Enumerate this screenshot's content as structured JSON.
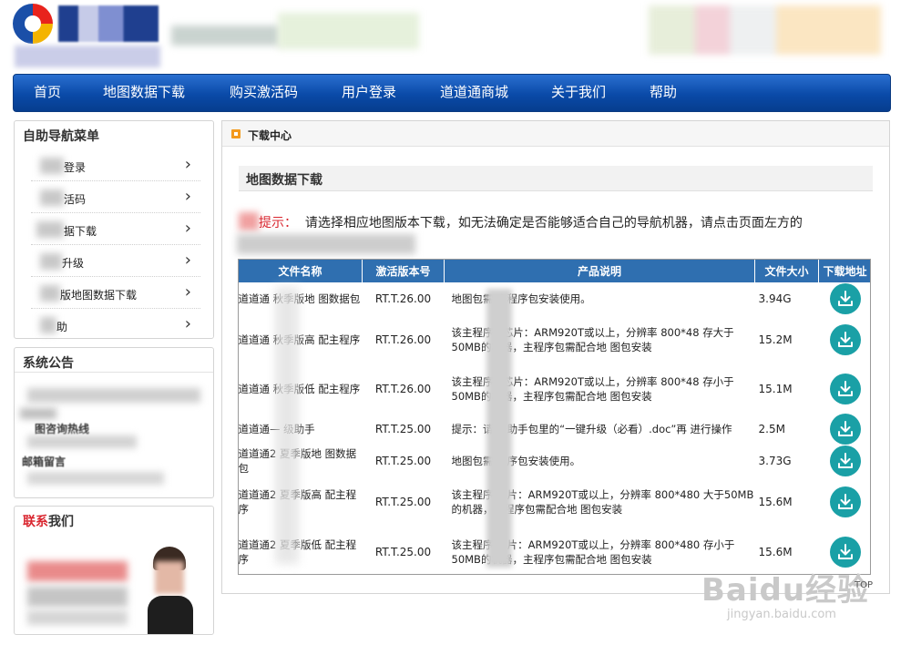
{
  "nav": {
    "items": [
      "首页",
      "地图数据下载",
      "购买激活码",
      "用户登录",
      "道道通商城",
      "关于我们",
      "帮助"
    ]
  },
  "sidebar": {
    "menu_title": "自助导航菜单",
    "menu_items": [
      "登录",
      "活码",
      "据下载",
      "升级",
      "版地图数据下载",
      "助"
    ],
    "notice_title": "系统公告",
    "notice_lines": [
      "图咨询热线",
      "邮箱留言"
    ],
    "contact_title_red": "联系",
    "contact_title_rest": "我们"
  },
  "main": {
    "header_title": "下载中心",
    "section_title": "地图数据下载",
    "tip_label": "提示：",
    "tip_text": "请选择相应地图版本下载，如无法确定是否能够适合自己的导航机器，请点击页面左方的"
  },
  "table": {
    "headers": [
      "文件名称",
      "激活版本号",
      "产品说明",
      "文件大小",
      "下载地址"
    ],
    "rows": [
      {
        "name": [
          "道道通",
          "秋季版地",
          "图数据包"
        ],
        "version": "RT.T.26.00",
        "desc": [
          "地图包需",
          "主程序包安装使用。"
        ],
        "size": "3.94G"
      },
      {
        "name": [
          "道道通",
          "秋季版高",
          "配主程序"
        ],
        "version": "RT.T.26.00",
        "desc": [
          "该主程序",
          "F芯片：ARM920T或以上，分辨率",
          "800*48",
          "存大于50MB的机器，主程序包需配合地",
          "图包安装"
        ],
        "size": "15.2M"
      },
      {
        "name": [
          "道道通",
          "秋季版低",
          "配主程序"
        ],
        "version": "RT.T.26.00",
        "desc": [
          "该主程序",
          "F芯片：ARM920T或以上，分辨率",
          "800*48",
          "存小于50MB的机器，主程序包需配合地",
          "图包安装"
        ],
        "size": "15.1M"
      },
      {
        "name": [
          "道道通—",
          "级助手"
        ],
        "version": "RT.T.25.00",
        "desc": [
          "提示：请",
          "级助手包里的“一键升级（必看）.doc”再",
          "进行操作"
        ],
        "size": "2.5M"
      },
      {
        "name": [
          "道道通2",
          "夏季版地",
          "图数据包"
        ],
        "version": "RT.T.25.00",
        "desc": [
          "地图包需",
          "程序包安装使用。"
        ],
        "size": "3.73G"
      },
      {
        "name": [
          "道道通2",
          "夏季版高",
          "配主程序"
        ],
        "version": "RT.T.25.00",
        "desc": [
          "该主程序",
          "芯片：ARM920T或以上，分辨率",
          "800*480",
          "大于50MB的机器，主程序包需配合地",
          "图包安装"
        ],
        "size": "15.6M"
      },
      {
        "name": [
          "道道通2",
          "夏季版低",
          "配主程序"
        ],
        "version": "RT.T.25.00",
        "desc": [
          "该主程序",
          "芯片：ARM920T或以上，分辨率",
          "800*480",
          "存小于50MB的机器，主程序包需配合地",
          "图包安装"
        ],
        "size": "15.6M"
      }
    ]
  },
  "watermark": {
    "big": "Baidu经验",
    "small": "jingyan.baidu.com",
    "top": "TOP"
  },
  "colors": {
    "nav": "#0a4aa8",
    "table_header": "#2f6fb0",
    "download_button": "#1aa0a6",
    "tip_red": "#d9262f",
    "header_icon": "#f39a1d"
  },
  "icons": {
    "download": "download-icon",
    "chevron": "chevron-right-icon"
  }
}
